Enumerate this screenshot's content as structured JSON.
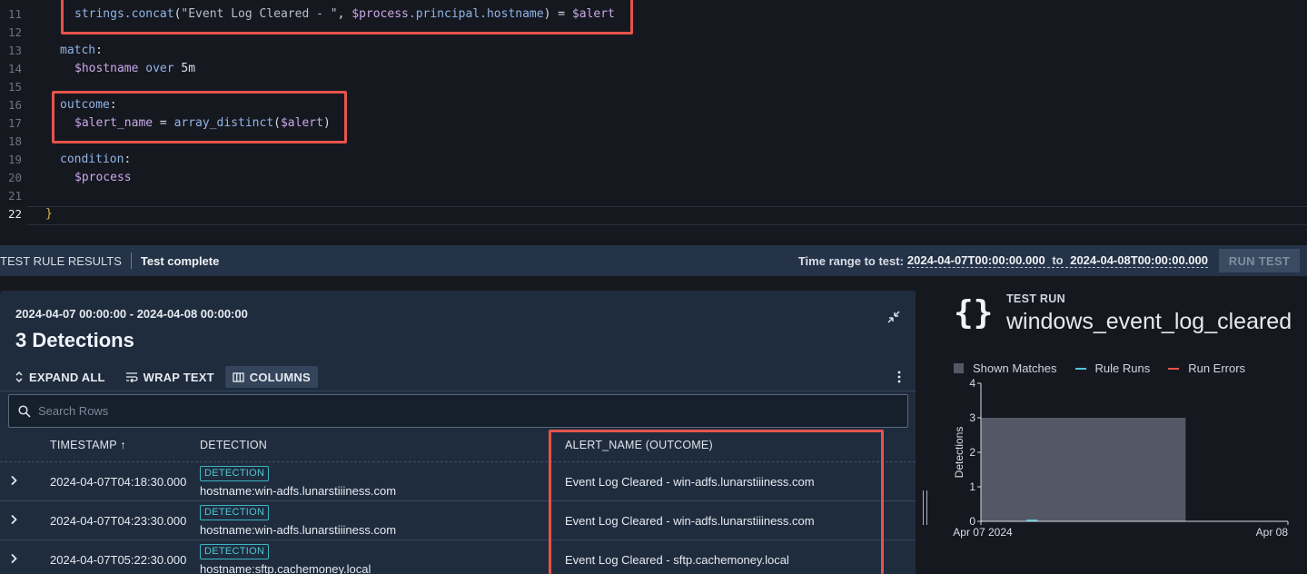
{
  "editor": {
    "lines": [
      {
        "n": "11",
        "tokens": [
          [
            "tk-ident",
            "strings.concat"
          ],
          [
            "tk-punct",
            "("
          ],
          [
            "tk-str",
            "\"Event Log Cleared - \""
          ],
          [
            "tk-punct",
            ", "
          ],
          [
            "tk-var",
            "$process"
          ],
          [
            "tk-ident",
            ".principal.hostname"
          ],
          [
            "tk-punct",
            ") = "
          ],
          [
            "tk-var",
            "$alert"
          ]
        ]
      },
      {
        "n": "12",
        "tokens": []
      },
      {
        "n": "13",
        "tokens": [
          [
            "tk-key",
            "match"
          ],
          [
            "tk-punct",
            ":"
          ]
        ]
      },
      {
        "n": "14",
        "tokens": [
          [
            "tk-var",
            "$hostname"
          ],
          [
            "tk-punct",
            " "
          ],
          [
            "tk-kw",
            "over"
          ],
          [
            "tk-punct",
            " "
          ],
          [
            "tk-num",
            "5m"
          ]
        ]
      },
      {
        "n": "15",
        "tokens": []
      },
      {
        "n": "16",
        "tokens": [
          [
            "tk-key",
            "outcome"
          ],
          [
            "tk-punct",
            ":"
          ]
        ]
      },
      {
        "n": "17",
        "tokens": [
          [
            "tk-var",
            "$alert_name"
          ],
          [
            "tk-punct",
            " = "
          ],
          [
            "tk-ident",
            "array_distinct"
          ],
          [
            "tk-punct",
            "("
          ],
          [
            "tk-var",
            "$alert"
          ],
          [
            "tk-punct",
            ")"
          ]
        ]
      },
      {
        "n": "18",
        "tokens": []
      },
      {
        "n": "19",
        "tokens": [
          [
            "tk-key",
            "condition"
          ],
          [
            "tk-punct",
            ":"
          ]
        ]
      },
      {
        "n": "20",
        "tokens": [
          [
            "tk-var",
            "$process"
          ]
        ]
      },
      {
        "n": "21",
        "tokens": []
      },
      {
        "n": "22",
        "tokens": [
          [
            "tk-brace",
            "}"
          ]
        ]
      }
    ]
  },
  "results_bar": {
    "title": "TEST RULE RESULTS",
    "status": "Test complete",
    "time_range_label": "Time range to test:",
    "time_from": "2024-04-07T00:00:00.000",
    "time_to_word": "to",
    "time_to": "2024-04-08T00:00:00.000",
    "run_test_label": "RUN TEST"
  },
  "panel": {
    "range": "2024-04-07 00:00:00 - 2024-04-08 00:00:00",
    "count_label": "3 Detections",
    "toolbar": {
      "expand_all": "EXPAND ALL",
      "wrap_text": "WRAP TEXT",
      "columns": "COLUMNS"
    },
    "search_placeholder": "Search Rows",
    "columns": {
      "timestamp": "TIMESTAMP ↑",
      "detection": "DETECTION",
      "alert_name": "ALERT_NAME (OUTCOME)"
    },
    "rows": [
      {
        "timestamp": "2024-04-07T04:18:30.000",
        "badge": "DETECTION",
        "host": "hostname:win-adfs.lunarstiiiness.com",
        "alert": "Event Log Cleared - win-adfs.lunarstiiiness.com"
      },
      {
        "timestamp": "2024-04-07T04:23:30.000",
        "badge": "DETECTION",
        "host": "hostname:win-adfs.lunarstiiiness.com",
        "alert": "Event Log Cleared - win-adfs.lunarstiiiness.com"
      },
      {
        "timestamp": "2024-04-07T05:22:30.000",
        "badge": "DETECTION",
        "host": "hostname:sftp.cachemoney.local",
        "alert": "Event Log Cleared - sftp.cachemoney.local"
      }
    ]
  },
  "test_run": {
    "icon": "braces-icon",
    "braces": "{}",
    "label": "TEST RUN",
    "name": "windows_event_log_cleared"
  },
  "colors": {
    "highlight": "#e5544b",
    "shown_matches": "#545866",
    "rule_runs": "#4fc6d6",
    "run_errors": "#e5544b"
  },
  "chart_data": {
    "type": "bar",
    "title": "",
    "ylabel": "Detections",
    "xlabel": "",
    "ylim": [
      0,
      4
    ],
    "yticks": [
      "0",
      "1",
      "2",
      "3",
      "4"
    ],
    "xticks": [
      "Apr 07 2024",
      "Apr 08"
    ],
    "legend_position": "top",
    "series": [
      {
        "name": "Shown Matches",
        "color": "#545866",
        "bars": [
          {
            "start": "2024-04-07T00:00",
            "end": "2024-04-07T16:00",
            "value": 3
          }
        ]
      },
      {
        "name": "Rule Runs",
        "color": "#4fc6d6",
        "points": [
          {
            "x": "2024-04-07T04:00",
            "value": 0
          }
        ]
      },
      {
        "name": "Run Errors",
        "color": "#e5544b",
        "points": []
      }
    ]
  }
}
